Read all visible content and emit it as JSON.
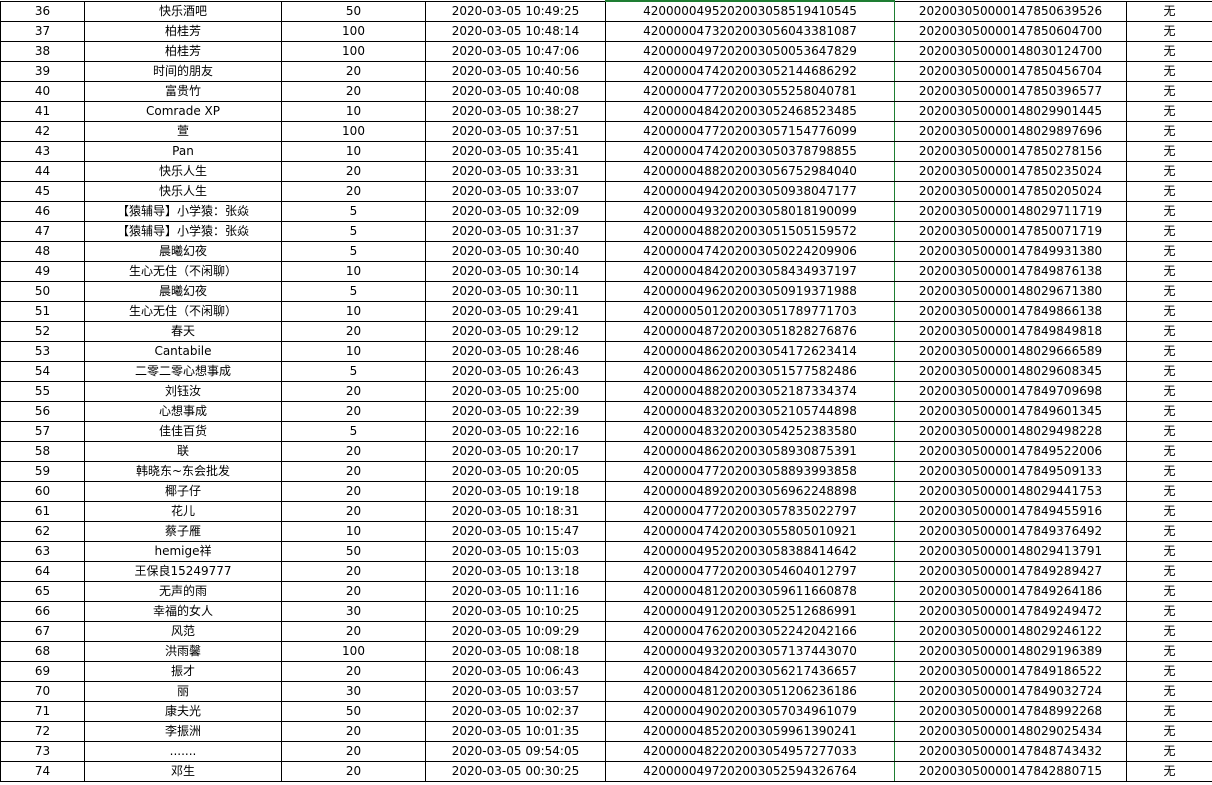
{
  "sheet": {
    "rows": [
      {
        "no": "36",
        "name": "快乐酒吧",
        "amount": "50",
        "time": "2020-03-05 10:49:25",
        "txn": "4200000495202003058519410545",
        "order": "2020030500001478506395​26",
        "refund": "无"
      },
      {
        "no": "37",
        "name": "柏桂芳",
        "amount": "100",
        "time": "2020-03-05 10:48:14",
        "txn": "4200000473202003056043381087",
        "order": "202003050000147850604700",
        "refund": "无"
      },
      {
        "no": "38",
        "name": "柏桂芳",
        "amount": "100",
        "time": "2020-03-05 10:47:06",
        "txn": "4200000497202003050053647829",
        "order": "202003050000148030124700",
        "refund": "无"
      },
      {
        "no": "39",
        "name": "时间的朋友",
        "amount": "20",
        "time": "2020-03-05 10:40:56",
        "txn": "4200000474202003052144686292",
        "order": "202003050000147850456704",
        "refund": "无"
      },
      {
        "no": "40",
        "name": "富贵竹",
        "amount": "20",
        "time": "2020-03-05 10:40:08",
        "txn": "4200000477202003055258040781",
        "order": "202003050000147850396577",
        "refund": "无"
      },
      {
        "no": "41",
        "name": "Comrade XP",
        "amount": "10",
        "time": "2020-03-05 10:38:27",
        "txn": "4200000484202003052468523485",
        "order": "202003050000148029901445",
        "refund": "无"
      },
      {
        "no": "42",
        "name": "萱",
        "amount": "100",
        "time": "2020-03-05 10:37:51",
        "txn": "4200000477202003057154776099",
        "order": "202003050000148029897696",
        "refund": "无"
      },
      {
        "no": "43",
        "name": "Pan",
        "amount": "10",
        "time": "2020-03-05 10:35:41",
        "txn": "4200000474202003050378798855",
        "order": "202003050000147850278156",
        "refund": "无"
      },
      {
        "no": "44",
        "name": "快乐人生",
        "amount": "20",
        "time": "2020-03-05 10:33:31",
        "txn": "4200000488202003056752984040",
        "order": "202003050000147850235024",
        "refund": "无"
      },
      {
        "no": "45",
        "name": "快乐人生",
        "amount": "20",
        "time": "2020-03-05 10:33:07",
        "txn": "4200000494202003050938047177",
        "order": "202003050000147850205024",
        "refund": "无"
      },
      {
        "no": "46",
        "name": "【猿辅导】小学猿：张焱",
        "amount": "5",
        "time": "2020-03-05 10:32:09",
        "txn": "4200000493202003058018190099",
        "order": "202003050000148029711719",
        "refund": "无"
      },
      {
        "no": "47",
        "name": "【猿辅导】小学猿：张焱",
        "amount": "5",
        "time": "2020-03-05 10:31:37",
        "txn": "4200000488202003051505159572",
        "order": "202003050000147850071719",
        "refund": "无"
      },
      {
        "no": "48",
        "name": "晨曦幻夜",
        "amount": "5",
        "time": "2020-03-05 10:30:40",
        "txn": "4200000474202003050224209906",
        "order": "202003050000147849931380",
        "refund": "无"
      },
      {
        "no": "49",
        "name": "生心无住（不闲聊）",
        "amount": "10",
        "time": "2020-03-05 10:30:14",
        "txn": "4200000484202003058434937197",
        "order": "202003050000147849876138",
        "refund": "无"
      },
      {
        "no": "50",
        "name": "晨曦幻夜",
        "amount": "5",
        "time": "2020-03-05 10:30:11",
        "txn": "4200000496202003050919371988",
        "order": "202003050000148029671380",
        "refund": "无"
      },
      {
        "no": "51",
        "name": "生心无住（不闲聊）",
        "amount": "10",
        "time": "2020-03-05 10:29:41",
        "txn": "4200000501202003051789771703",
        "order": "202003050000147849866138",
        "refund": "无"
      },
      {
        "no": "52",
        "name": "春天",
        "amount": "20",
        "time": "2020-03-05 10:29:12",
        "txn": "4200000487202003051828276876",
        "order": "202003050000147849849818",
        "refund": "无"
      },
      {
        "no": "53",
        "name": "Cantabile",
        "amount": "10",
        "time": "2020-03-05 10:28:46",
        "txn": "4200000486202003054172623414",
        "order": "202003050000148029666589",
        "refund": "无"
      },
      {
        "no": "54",
        "name": "二零二零心想事成",
        "amount": "5",
        "time": "2020-03-05 10:26:43",
        "txn": "4200000486202003051577582486",
        "order": "202003050000148029608345",
        "refund": "无"
      },
      {
        "no": "55",
        "name": "刘钰汝",
        "amount": "20",
        "time": "2020-03-05 10:25:00",
        "txn": "4200000488202003052187334374",
        "order": "202003050000147849709698",
        "refund": "无"
      },
      {
        "no": "56",
        "name": "心想事成",
        "amount": "20",
        "time": "2020-03-05 10:22:39",
        "txn": "4200000483202003052105744898",
        "order": "202003050000147849601345",
        "refund": "无"
      },
      {
        "no": "57",
        "name": "佳佳百货",
        "amount": "5",
        "time": "2020-03-05 10:22:16",
        "txn": "4200000483202003054252383580",
        "order": "202003050000148029498228",
        "refund": "无"
      },
      {
        "no": "58",
        "name": "联",
        "amount": "20",
        "time": "2020-03-05 10:20:17",
        "txn": "4200000486202003058930875391",
        "order": "202003050000147849522006",
        "refund": "无"
      },
      {
        "no": "59",
        "name": "韩晓东~东会批发",
        "amount": "20",
        "time": "2020-03-05 10:20:05",
        "txn": "4200000477202003058893993858",
        "order": "202003050000147849509133",
        "refund": "无"
      },
      {
        "no": "60",
        "name": "椰子仔",
        "amount": "20",
        "time": "2020-03-05 10:19:18",
        "txn": "4200000489202003056962248898",
        "order": "202003050000148029441753",
        "refund": "无"
      },
      {
        "no": "61",
        "name": "花儿",
        "amount": "20",
        "time": "2020-03-05 10:18:31",
        "txn": "4200000477202003057835022797",
        "order": "202003050000147849455916",
        "refund": "无"
      },
      {
        "no": "62",
        "name": "蔡子雁",
        "amount": "10",
        "time": "2020-03-05 10:15:47",
        "txn": "4200000474202003055805010921",
        "order": "202003050000147849376492",
        "refund": "无"
      },
      {
        "no": "63",
        "name": "hemige祥",
        "amount": "50",
        "time": "2020-03-05 10:15:03",
        "txn": "4200000495202003058388414642",
        "order": "202003050000148029413791",
        "refund": "无"
      },
      {
        "no": "64",
        "name": "王保良15249777",
        "amount": "20",
        "time": "2020-03-05 10:13:18",
        "txn": "4200000477202003054604012797",
        "order": "202003050000147849289427",
        "refund": "无"
      },
      {
        "no": "65",
        "name": "无声的雨",
        "amount": "20",
        "time": "2020-03-05 10:11:16",
        "txn": "4200000481202003059611660878",
        "order": "202003050000147849264186",
        "refund": "无"
      },
      {
        "no": "66",
        "name": "幸福的女人",
        "amount": "30",
        "time": "2020-03-05 10:10:25",
        "txn": "4200000491202003052512686991",
        "order": "202003050000147849249472",
        "refund": "无"
      },
      {
        "no": "67",
        "name": "风范",
        "amount": "20",
        "time": "2020-03-05 10:09:29",
        "txn": "4200000476202003052242042166",
        "order": "202003050000148029246122",
        "refund": "无"
      },
      {
        "no": "68",
        "name": "洪雨馨",
        "amount": "100",
        "time": "2020-03-05 10:08:18",
        "txn": "4200000493202003057137443070",
        "order": "202003050000148029196389",
        "refund": "无"
      },
      {
        "no": "69",
        "name": "振才",
        "amount": "20",
        "time": "2020-03-05 10:06:43",
        "txn": "4200000484202003056217436657",
        "order": "202003050000147849186522",
        "refund": "无"
      },
      {
        "no": "70",
        "name": "丽",
        "amount": "30",
        "time": "2020-03-05 10:03:57",
        "txn": "4200000481202003051206236186",
        "order": "202003050000147849032724",
        "refund": "无"
      },
      {
        "no": "71",
        "name": "康夫光",
        "amount": "50",
        "time": "2020-03-05 10:02:37",
        "txn": "4200000490202003057034961079",
        "order": "202003050000147848992268",
        "refund": "无"
      },
      {
        "no": "72",
        "name": "李振洲",
        "amount": "20",
        "time": "2020-03-05 10:01:35",
        "txn": "4200000485202003059961390241",
        "order": "202003050000148029025434",
        "refund": "无"
      },
      {
        "no": "73",
        "name": ".......",
        "amount": "20",
        "time": "2020-03-05 09:54:05",
        "txn": "4200000482202003054957277033",
        "order": "202003050000147848743432",
        "refund": "无"
      },
      {
        "no": "74",
        "name": "邓生",
        "amount": "20",
        "time": "2020-03-05 00:30:25",
        "txn": "4200000497202003052594326764",
        "order": "202003050000147842880715",
        "refund": "无"
      }
    ]
  }
}
